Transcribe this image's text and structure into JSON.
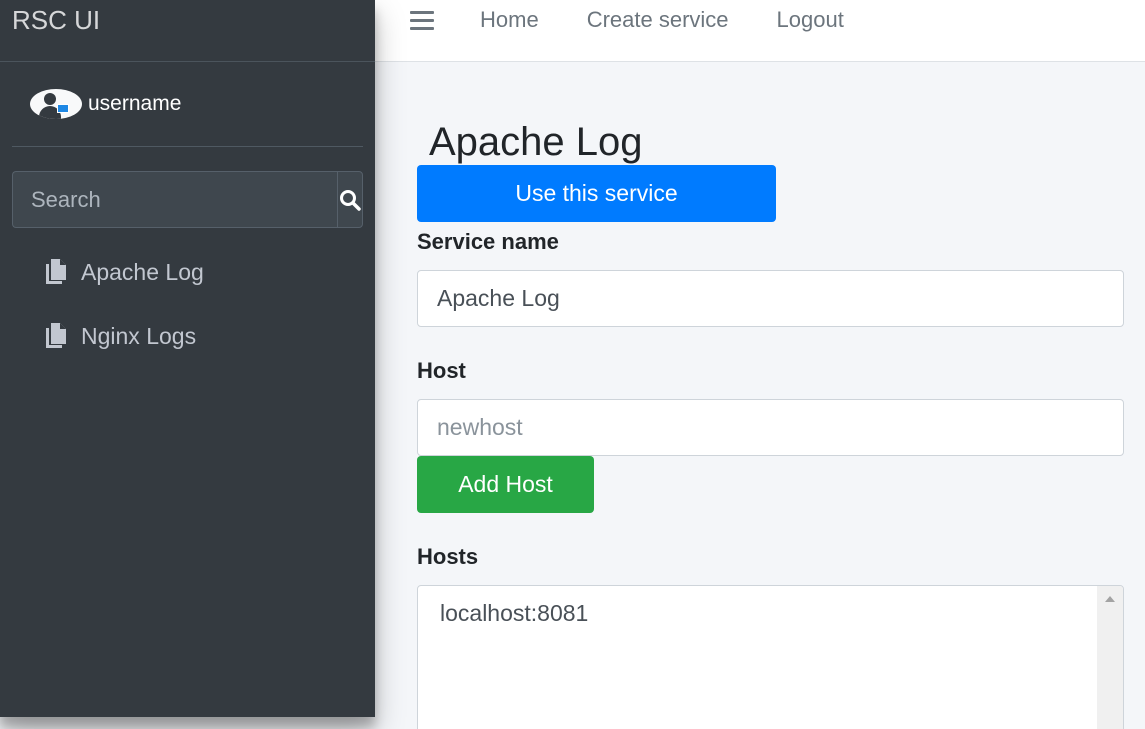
{
  "brand": {
    "title": "RSC UI"
  },
  "user": {
    "name": "username",
    "avatar_icon": "user-avatar-icon"
  },
  "search": {
    "placeholder": "Search",
    "icon": "search-icon"
  },
  "sidebar": {
    "items": [
      {
        "label": "Apache Log",
        "icon": "copy-icon"
      },
      {
        "label": "Nginx Logs",
        "icon": "copy-icon"
      }
    ]
  },
  "topnav": {
    "menu_icon": "hamburger-icon",
    "links": {
      "home": "Home",
      "create": "Create service",
      "logout": "Logout"
    }
  },
  "main": {
    "title": "Apache Log",
    "use_button": "Use this service",
    "service_name_label": "Service name",
    "service_name_value": "Apache Log",
    "host_label": "Host",
    "host_placeholder": "newhost",
    "add_host_button": "Add Host",
    "hosts_label": "Hosts",
    "hosts": [
      "localhost:8081"
    ]
  },
  "colors": {
    "sidebar_bg": "#343a40",
    "primary": "#007bff",
    "success": "#28a745",
    "content_bg": "#f4f6f9"
  }
}
